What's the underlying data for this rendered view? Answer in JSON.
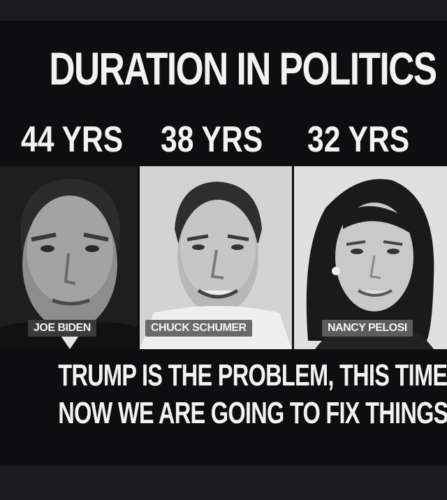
{
  "headline": "DURATION IN POLITICS",
  "durations": [
    {
      "years": "44 YRS",
      "name": "JOE BIDEN"
    },
    {
      "years": "38 YRS",
      "name": "CHUCK SCHUMER"
    },
    {
      "years": "32 YRS",
      "name": "NANCY PELOSI"
    }
  ],
  "tagline": {
    "line1": "TRUMP IS THE PROBLEM, THIS TIME.",
    "line2": "NOW WE ARE GOING TO FIX THINGS!"
  }
}
